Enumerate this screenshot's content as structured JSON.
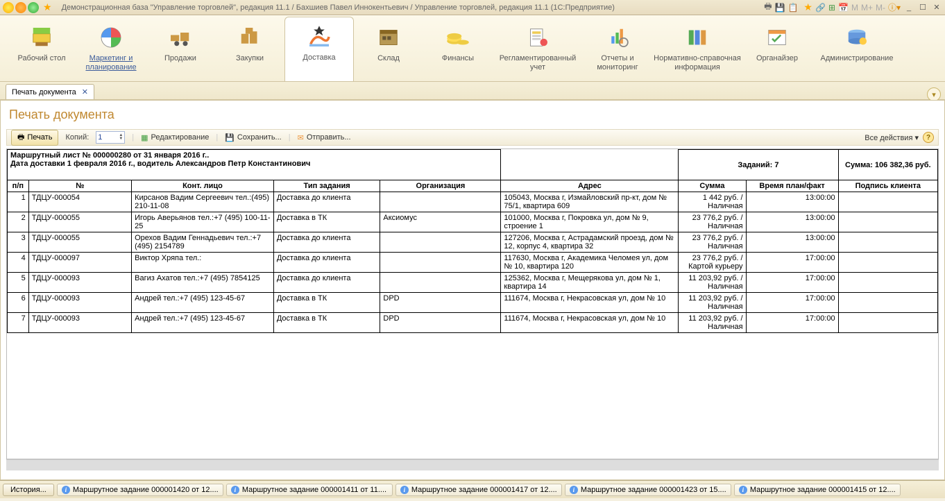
{
  "titlebar": {
    "title": "Демонстрационная база \"Управление торговлей\", редакция 11.1 / Бахшиев Павел Иннокентьевич / Управление торговлей, редакция 11.1  (1С:Предприятие)",
    "m_buttons": [
      "M",
      "M+",
      "M-"
    ]
  },
  "nav": {
    "items": [
      {
        "label": "Рабочий стол"
      },
      {
        "label": "Маркетинг и планирование"
      },
      {
        "label": "Продажи"
      },
      {
        "label": "Закупки"
      },
      {
        "label": "Доставка"
      },
      {
        "label": "Склад"
      },
      {
        "label": "Финансы"
      },
      {
        "label": "Регламентированный учет"
      },
      {
        "label": "Отчеты и мониторинг"
      },
      {
        "label": "Нормативно-справочная информация"
      },
      {
        "label": "Органайзер"
      },
      {
        "label": "Администрирование"
      }
    ]
  },
  "tab": {
    "label": "Печать документа"
  },
  "page": {
    "title": "Печать документа"
  },
  "toolbar": {
    "print": "Печать",
    "copies_label": "Копий:",
    "copies_value": "1",
    "edit": "Редактирование",
    "save": "Сохранить...",
    "send": "Отправить...",
    "all_actions": "Все действия"
  },
  "doc_header": {
    "line1": "Маршрутный лист № 000000280 от 31 января 2016 г..",
    "line2": "Дата доставки 1 февраля 2016 г., водитель Александров Петр Константинович",
    "tasks": "Заданий: 7",
    "sum": "Сумма: 106 382,36 руб."
  },
  "columns": {
    "pp": "п/п",
    "no": "№",
    "contact": "Конт. лицо",
    "type": "Тип задания",
    "org": "Организация",
    "addr": "Адрес",
    "sum": "Сумма",
    "time": "Время план/факт",
    "sign": "Подпись клиента"
  },
  "rows": [
    {
      "pp": "1",
      "no": "ТДЦУ-000054",
      "contact": "Кирсанов Вадим Сергеевич тел.:(495) 210-11-08",
      "type": "Доставка до клиента",
      "org": "",
      "addr": "105043, Москва г, Измайловский пр-кт, дом № 75/1, квартира 609",
      "sum": "1 442 руб. /Наличная",
      "time": "13:00:00"
    },
    {
      "pp": "2",
      "no": "ТДЦУ-000055",
      "contact": "Игорь Аверьянов тел.:+7 (495) 100-11-25",
      "type": "Доставка в ТК",
      "org": "Аксиомус",
      "addr": "101000, Москва г, Покровка ул, дом № 9, строение 1",
      "sum": "23 776,2 руб. /Наличная",
      "time": "13:00:00"
    },
    {
      "pp": "3",
      "no": "ТДЦУ-000055",
      "contact": "Орехов Вадим Геннадьевич тел.:+7 (495) 2154789",
      "type": "Доставка до клиента",
      "org": "",
      "addr": "127206, Москва г, Астрадамский проезд, дом № 12, корпус 4, квартира 32",
      "sum": "23 776,2 руб. /Наличная",
      "time": "13:00:00"
    },
    {
      "pp": "4",
      "no": "ТДЦУ-000097",
      "contact": "Виктор Хряпа тел.:",
      "type": "Доставка до клиента",
      "org": "",
      "addr": "117630, Москва г, Академика Челомея ул, дом № 10, квартира 120",
      "sum": "23 776,2 руб. /Картой курьеру",
      "time": "17:00:00"
    },
    {
      "pp": "5",
      "no": "ТДЦУ-000093",
      "contact": "Вагиз Ахатов тел.:+7 (495) 7854125",
      "type": "Доставка до клиента",
      "org": "",
      "addr": "125362, Москва г, Мещерякова ул, дом № 1, квартира 14",
      "sum": "11 203,92 руб. /Наличная",
      "time": "17:00:00"
    },
    {
      "pp": "6",
      "no": "ТДЦУ-000093",
      "contact": "Андрей тел.:+7 (495) 123-45-67",
      "type": "Доставка в ТК",
      "org": "DPD",
      "addr": "111674, Москва г, Некрасовская ул, дом № 10",
      "sum": "11 203,92 руб. /Наличная",
      "time": "17:00:00"
    },
    {
      "pp": "7",
      "no": "ТДЦУ-000093",
      "contact": "Андрей тел.:+7 (495) 123-45-67",
      "type": "Доставка в ТК",
      "org": "DPD",
      "addr": "111674, Москва г, Некрасовская ул, дом № 10",
      "sum": "11 203,92 руб. /Наличная",
      "time": "17:00:00"
    }
  ],
  "statusbar": {
    "history": "История...",
    "items": [
      "Маршрутное задание 000001420 от 12....",
      "Маршрутное задание 000001411 от 11....",
      "Маршрутное задание 000001417 от 12....",
      "Маршрутное задание 000001423 от 15....",
      "Маршрутное задание 000001415 от 12...."
    ]
  }
}
